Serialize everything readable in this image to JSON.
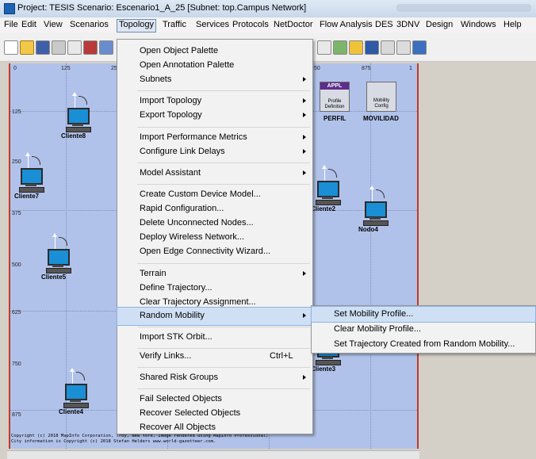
{
  "window": {
    "title": "Project: TESIS Scenario: Escenario1_A_25  [Subnet: top.Campus Network]"
  },
  "menubar": {
    "items": [
      "File",
      "Edit",
      "View",
      "Scenarios",
      "Topology",
      "Traffic",
      "Services",
      "Protocols",
      "NetDoctor",
      "Flow Analysis",
      "DES",
      "3DNV",
      "Design",
      "Windows",
      "Help"
    ],
    "active": "Topology"
  },
  "toolbar": {
    "icons": [
      "new-project-icon",
      "open-folder-icon",
      "save-icon",
      "print-icon",
      "cut-icon",
      "node-icon",
      "wireless-icon",
      "link-icon",
      "config-icon",
      "report-icon",
      "results-icon",
      "view-icon",
      "statistics-icon",
      "hybrid-icon"
    ]
  },
  "ruler": {
    "x": [
      "0",
      "125",
      "25",
      "50",
      "875",
      "1"
    ],
    "y": [
      "125",
      "250",
      "375",
      "500",
      "625",
      "750",
      "875"
    ]
  },
  "canvas": {
    "nodes": [
      "Cliente8",
      "Cliente7",
      "Cliente5",
      "Cliente4",
      "Cliente2",
      "Nodo4",
      "Cliente3"
    ],
    "config_nodes": [
      {
        "header": "APPL",
        "line1": "Profile",
        "line2": "Definition",
        "label": "PERFIL"
      },
      {
        "header": "",
        "line1": "Mobility",
        "line2": "Config",
        "label": "MOVILIDAD"
      }
    ],
    "copyright": [
      "Copyright (c) 2018 MapInfo Corporation, Troy, New York. Image rendered using MapInfo Professional;",
      "City information is Copyright (c) 2018 Stefan Helders www.world-gazetteer.com."
    ]
  },
  "topology_menu": {
    "items": [
      {
        "label": "Open Object Palette"
      },
      {
        "label": "Open Annotation Palette"
      },
      {
        "label": "Subnets",
        "submenu": true
      },
      {
        "label": "Import Topology",
        "submenu": true
      },
      {
        "label": "Export Topology",
        "submenu": true
      },
      {
        "label": "Import Performance Metrics",
        "submenu": true
      },
      {
        "label": "Configure Link Delays",
        "submenu": true
      },
      {
        "label": "Model Assistant",
        "submenu": true
      },
      {
        "label": "Create Custom Device Model..."
      },
      {
        "label": "Rapid Configuration..."
      },
      {
        "label": "Delete Unconnected Nodes..."
      },
      {
        "label": "Deploy Wireless Network..."
      },
      {
        "label": "Open Edge Connectivity Wizard..."
      },
      {
        "label": "Terrain",
        "submenu": true
      },
      {
        "label": "Define Trajectory..."
      },
      {
        "label": "Clear Trajectory Assignment..."
      },
      {
        "label": "Random Mobility",
        "submenu": true,
        "highlighted": true
      },
      {
        "label": "Import STK Orbit..."
      },
      {
        "label": "Verify Links...",
        "shortcut": "Ctrl+L"
      },
      {
        "label": "Shared Risk Groups",
        "submenu": true
      },
      {
        "label": "Fail Selected Objects"
      },
      {
        "label": "Recover Selected Objects"
      },
      {
        "label": "Recover All Objects"
      }
    ]
  },
  "random_mobility_submenu": {
    "items": [
      {
        "label": "Set Mobility Profile...",
        "highlighted": true
      },
      {
        "label": "Clear Mobility Profile..."
      },
      {
        "label": "Set Trajectory Created from Random Mobility..."
      }
    ]
  },
  "colors": {
    "canvas_bg": "#b1c2ea",
    "menu_highlight": "#cfe0f4",
    "canvas_border": "#c0392b"
  }
}
